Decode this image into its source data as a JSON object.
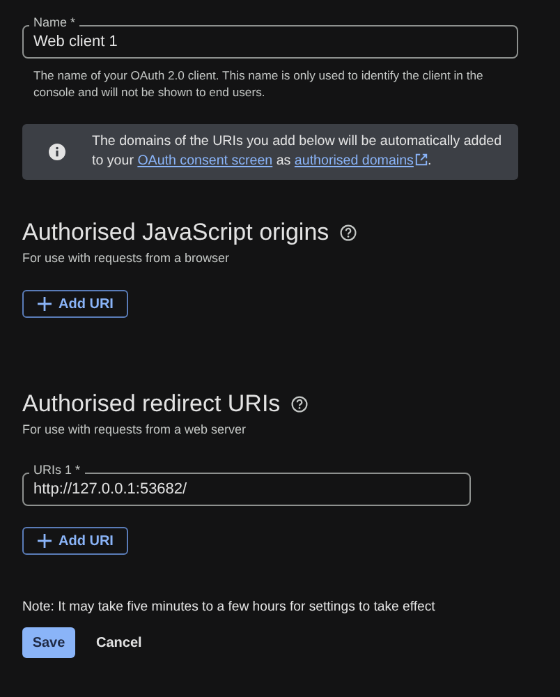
{
  "name_field": {
    "label": "Name *",
    "value": "Web client 1",
    "helper": "The name of your OAuth 2.0 client. This name is only used to identify the client in the console and will not be shown to end users."
  },
  "info_banner": {
    "text_before": "The domains of the URIs you add below will be automatically added to your ",
    "link_1": "OAuth consent screen",
    "text_middle": " as ",
    "link_2": "authorised domains",
    "text_after": "."
  },
  "sections": [
    {
      "title": "Authorised JavaScript origins",
      "subtitle": "For use with requests from a browser",
      "add_button": "Add URI"
    },
    {
      "title": "Authorised redirect URIs",
      "subtitle": "For use with requests from a web server",
      "fields": [
        {
          "label": "URIs 1 *",
          "value": "http://127.0.0.1:53682/"
        }
      ],
      "add_button": "Add URI"
    }
  ],
  "note": "Note: It may take five minutes to a few hours for settings to take effect",
  "buttons": [
    {
      "label": "Save",
      "kind": "primary"
    },
    {
      "label": "Cancel",
      "kind": "text"
    }
  ]
}
